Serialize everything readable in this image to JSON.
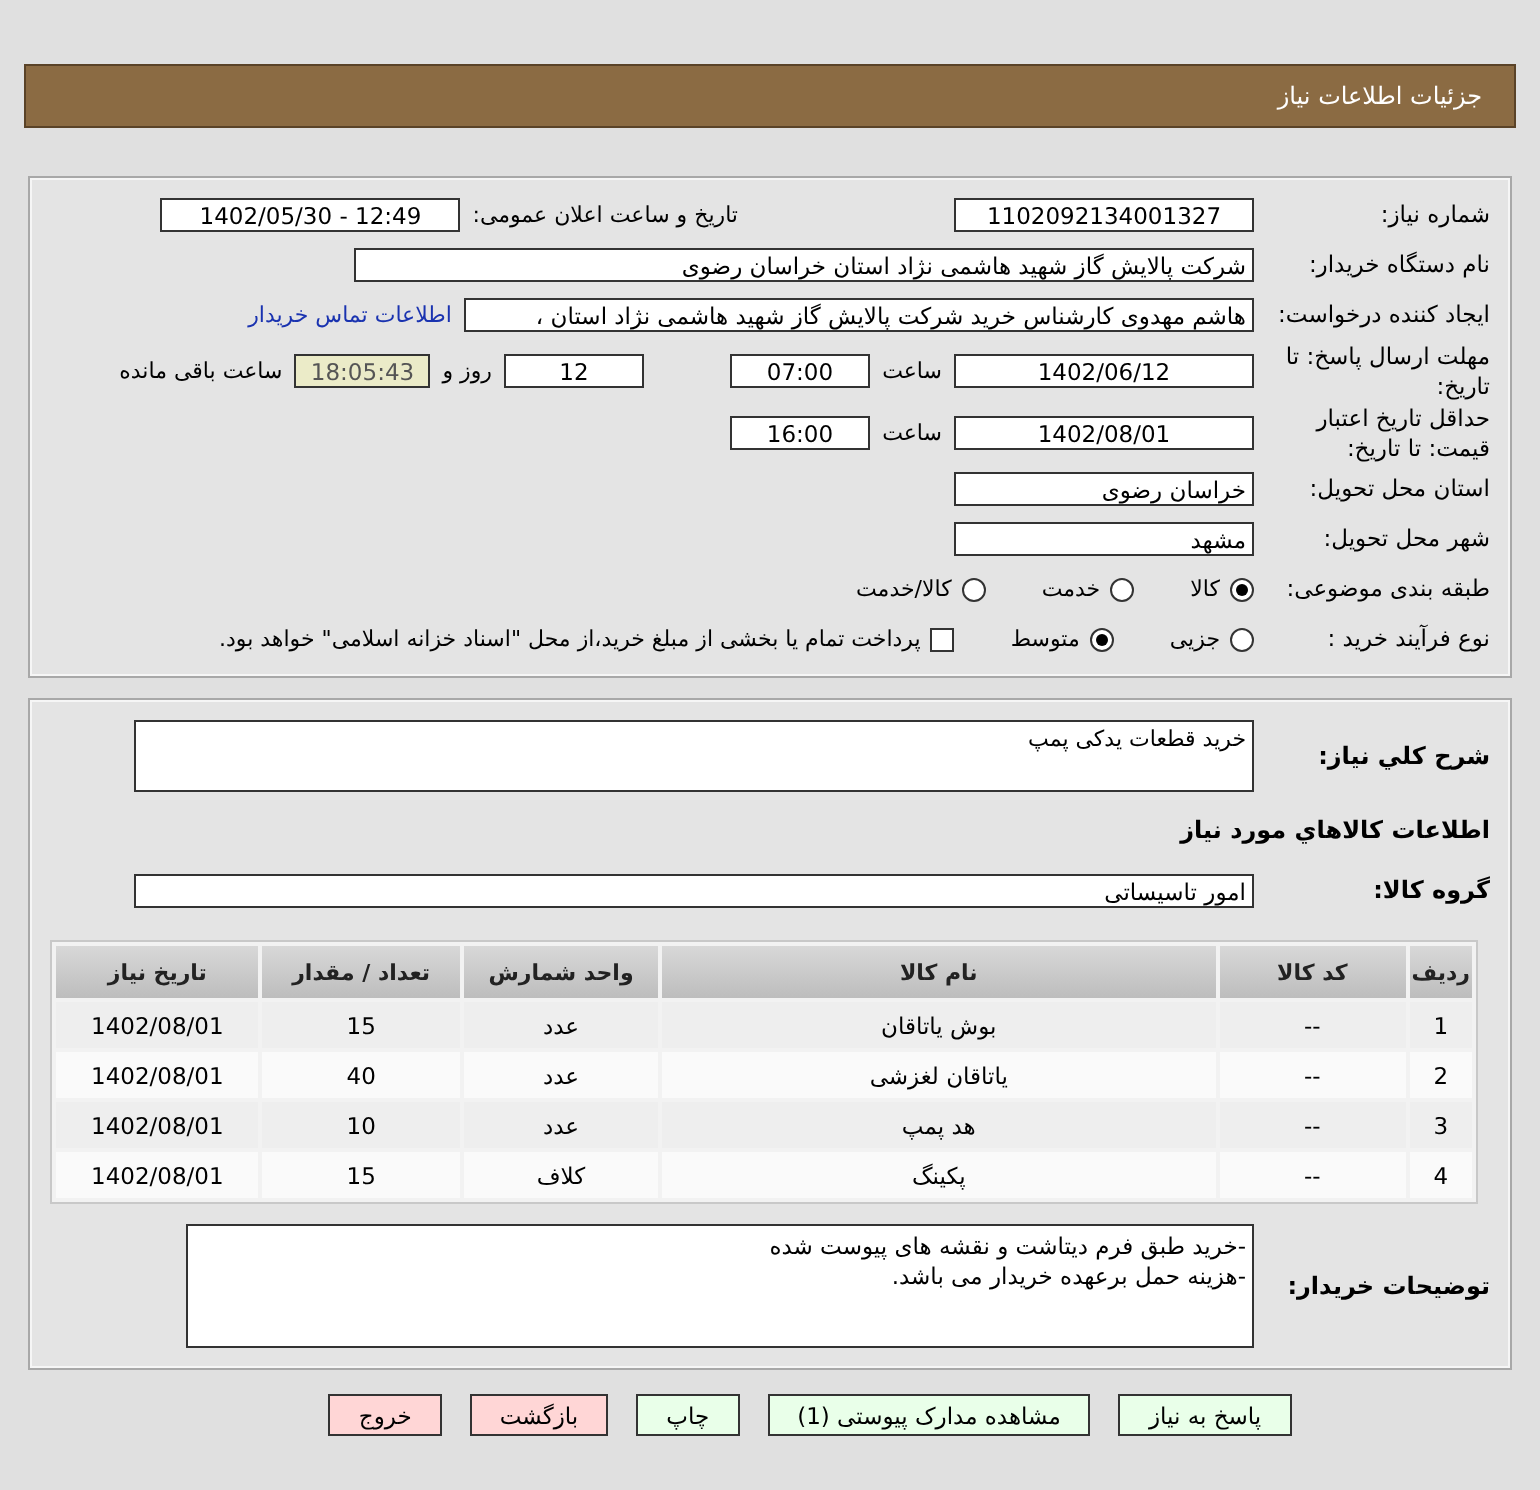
{
  "header": {
    "title": "جزئیات اطلاعات نیاز"
  },
  "need_number": {
    "label": "شماره نیاز:",
    "value": "1102092134001327"
  },
  "announce": {
    "label": "تاریخ و ساعت اعلان عمومی:",
    "value": "1402/05/30 - 12:49"
  },
  "buyer_org": {
    "label": "نام دستگاه خریدار:",
    "value": "شرکت پالایش گاز شهید هاشمی نژاد   استان خراسان رضوی"
  },
  "creator": {
    "label": "ایجاد کننده درخواست:",
    "value": "هاشم مهدوی کارشناس خرید شرکت پالایش گاز شهید هاشمی نژاد   استان ،",
    "contact_link": "اطلاعات تماس خریدار"
  },
  "reply_deadline": {
    "label": "مهلت ارسال پاسخ: تا تاریخ:",
    "date": "1402/06/12",
    "time_label": "ساعت",
    "time": "07:00",
    "days": "12",
    "days_label": "روز و",
    "remaining": "18:05:43",
    "remaining_label": "ساعت باقی مانده"
  },
  "price_validity": {
    "label": "حداقل تاریخ اعتبار قیمت: تا تاریخ:",
    "date": "1402/08/01",
    "time_label": "ساعت",
    "time": "16:00"
  },
  "delivery_province": {
    "label": "استان محل تحویل:",
    "value": "خراسان رضوی"
  },
  "delivery_city": {
    "label": "شهر محل تحویل:",
    "value": "مشهد"
  },
  "category": {
    "label": "طبقه بندی موضوعی:",
    "options": [
      {
        "label": "کالا",
        "selected": true
      },
      {
        "label": "خدمت",
        "selected": false
      },
      {
        "label": "کالا/خدمت",
        "selected": false
      }
    ]
  },
  "process": {
    "label": "نوع فرآیند خرید :",
    "options": [
      {
        "label": "جزیی",
        "selected": false
      },
      {
        "label": "متوسط",
        "selected": true
      }
    ],
    "treasury": {
      "checked": false,
      "text": "پرداخت تمام یا بخشی از مبلغ خرید،از محل \"اسناد خزانه اسلامی\" خواهد بود."
    }
  },
  "description": {
    "label": "شرح کلي نياز:",
    "value": "خرید قطعات یدکی پمپ"
  },
  "goods_title": "اطلاعات کالاهاي مورد نياز",
  "goods_group": {
    "label": "گروه کالا:",
    "value": "امور تاسیساتی"
  },
  "table": {
    "columns": [
      "ردیف",
      "کد کالا",
      "نام کالا",
      "واحد شمارش",
      "تعداد / مقدار",
      "تاریخ نیاز"
    ],
    "rows": [
      [
        "1",
        "--",
        "بوش یاتاقان",
        "عدد",
        "15",
        "1402/08/01"
      ],
      [
        "2",
        "--",
        "یاتاقان لغزشی",
        "عدد",
        "40",
        "1402/08/01"
      ],
      [
        "3",
        "--",
        "هد پمپ",
        "عدد",
        "10",
        "1402/08/01"
      ],
      [
        "4",
        "--",
        "پکینگ",
        "کلاف",
        "15",
        "1402/08/01"
      ]
    ]
  },
  "buyer_notes": {
    "label": "توضیحات خریدار:",
    "lines": [
      "-خرید طبق فرم دیتاشت و نقشه های پیوست شده",
      "-هزینه حمل برعهده خریدار می باشد."
    ]
  },
  "buttons": [
    {
      "label": "پاسخ به نیاز",
      "kind": "action"
    },
    {
      "label": "مشاهده مدارک پیوستی (1)",
      "kind": "action"
    },
    {
      "label": "چاپ",
      "kind": "action"
    },
    {
      "label": "بازگشت",
      "kind": "danger"
    },
    {
      "label": "خروج",
      "kind": "danger"
    }
  ]
}
